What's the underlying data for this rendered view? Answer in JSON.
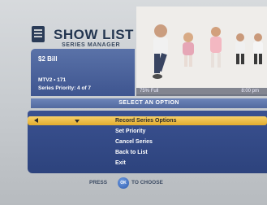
{
  "header": {
    "title": "SHOW LIST",
    "subtitle": "SERIES MANAGER"
  },
  "info": {
    "title": "$2 Bill",
    "line1": "MTV2 • 171",
    "line2": "Series Priority: 4 of 7"
  },
  "video_bar": {
    "left": "75% Full",
    "right": "8:00 pm"
  },
  "menu": {
    "header": "SELECT AN OPTION",
    "items": [
      {
        "label": "Record Series Options",
        "selected": true
      },
      {
        "label": "Set Priority",
        "selected": false
      },
      {
        "label": "Cancel Series",
        "selected": false
      },
      {
        "label": "Back to List",
        "selected": false
      },
      {
        "label": "Exit",
        "selected": false
      }
    ]
  },
  "footer": {
    "press": "PRESS",
    "ok": "OK",
    "to_choose": "TO CHOOSE"
  },
  "colors": {
    "panel_blue": "#3e5590",
    "highlight_gold": "#e2ac2e",
    "background_gray": "#c6cace"
  }
}
